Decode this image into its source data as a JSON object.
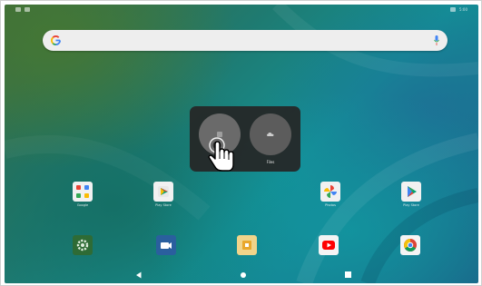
{
  "status_bar": {
    "right_text": "5:00"
  },
  "search_bar": {
    "google_icon": "google-g-icon",
    "mic_icon": "mic-icon"
  },
  "folder": {
    "apps": [
      {
        "label": "",
        "icon": "app-icon"
      },
      {
        "label": "Files",
        "icon": "cloud-icon"
      }
    ]
  },
  "home_row_1": [
    {
      "label": "Google",
      "icon": "google-folder-icon"
    },
    {
      "label": "Play Store",
      "icon": "play-store-icon"
    },
    {
      "label": "",
      "icon": ""
    },
    {
      "label": "",
      "icon": ""
    },
    {
      "label": "Photos",
      "icon": "photos-icon"
    },
    {
      "label": "Play Store",
      "icon": "play-store-icon"
    }
  ],
  "home_row_2": [
    {
      "label": "",
      "icon": "settings-icon"
    },
    {
      "label": "",
      "icon": "meet-icon"
    },
    {
      "label": "",
      "icon": "files-icon"
    },
    {
      "label": "",
      "icon": "youtube-icon"
    },
    {
      "label": "",
      "icon": "chrome-icon"
    }
  ],
  "nav": {
    "back": "back-icon",
    "home": "home-icon",
    "recents": "recents-icon"
  },
  "colors": {
    "wallpaper_dark": "#1b5f86",
    "wallpaper_teal": "#139096",
    "wallpaper_green": "#3f6b3a",
    "folder_bg": "#262626",
    "search_bg": "#eeeeee"
  }
}
